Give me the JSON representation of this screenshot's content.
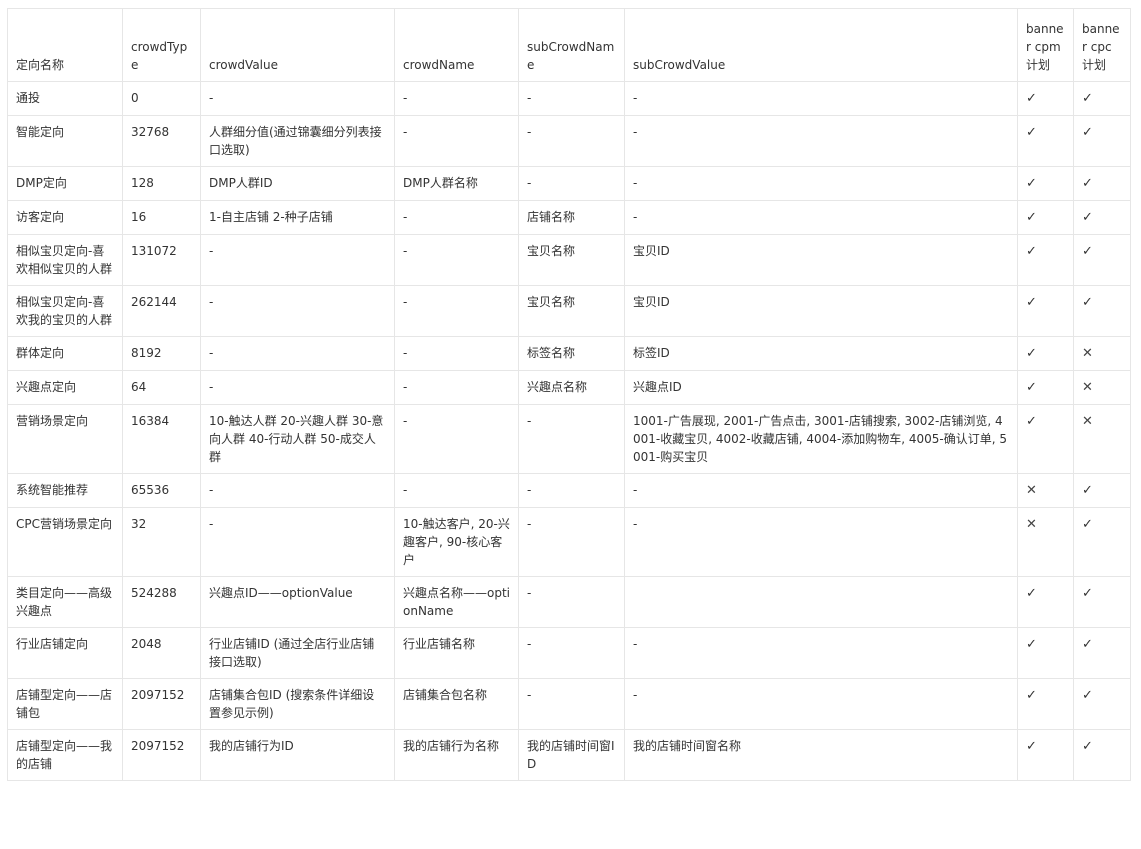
{
  "headers": [
    "定向名称",
    "crowdType",
    "crowdValue",
    "crowdName",
    "subCrowdName",
    "subCrowdValue",
    "banner cpm计划",
    "banner cpc计划"
  ],
  "marks": {
    "yes": "✓",
    "no": "✕"
  },
  "rows": [
    {
      "name": "通投",
      "type": "0",
      "value": "-",
      "crowdName": "-",
      "subName": "-",
      "subValue": "-",
      "cpm": "yes",
      "cpc": "yes"
    },
    {
      "name": "智能定向",
      "type": "32768",
      "value": "人群细分值(通过锦囊细分列表接口选取)",
      "crowdName": "-",
      "subName": "-",
      "subValue": "-",
      "cpm": "yes",
      "cpc": "yes"
    },
    {
      "name": "DMP定向",
      "type": "128",
      "value": "DMP人群ID",
      "crowdName": "DMP人群名称",
      "subName": "-",
      "subValue": "-",
      "cpm": "yes",
      "cpc": "yes"
    },
    {
      "name": "访客定向",
      "type": "16",
      "value": "1-自主店铺 2-种子店铺",
      "crowdName": "-",
      "subName": "店铺名称",
      "subValue": "-",
      "cpm": "yes",
      "cpc": "yes"
    },
    {
      "name": "相似宝贝定向-喜欢相似宝贝的人群",
      "type": "131072",
      "value": "-",
      "crowdName": "-",
      "subName": "宝贝名称",
      "subValue": "宝贝ID",
      "cpm": "yes",
      "cpc": "yes"
    },
    {
      "name": "相似宝贝定向-喜欢我的宝贝的人群",
      "type": "262144",
      "value": "-",
      "crowdName": "-",
      "subName": "宝贝名称",
      "subValue": "宝贝ID",
      "cpm": "yes",
      "cpc": "yes"
    },
    {
      "name": "群体定向",
      "type": "8192",
      "value": "-",
      "crowdName": "-",
      "subName": "标签名称",
      "subValue": "标签ID",
      "cpm": "yes",
      "cpc": "no"
    },
    {
      "name": "兴趣点定向",
      "type": "64",
      "value": "-",
      "crowdName": "-",
      "subName": "兴趣点名称",
      "subValue": "兴趣点ID",
      "cpm": "yes",
      "cpc": "no"
    },
    {
      "name": "营销场景定向",
      "type": "16384",
      "value": "10-触达人群 20-兴趣人群 30-意向人群 40-行动人群 50-成交人群",
      "crowdName": "-",
      "subName": "-",
      "subValue": "1001-广告展现, 2001-广告点击, 3001-店铺搜索, 3002-店铺浏览, 4001-收藏宝贝, 4002-收藏店铺, 4004-添加购物车, 4005-确认订单, 5001-购买宝贝",
      "cpm": "yes",
      "cpc": "no"
    },
    {
      "name": "系统智能推荐",
      "type": "65536",
      "value": "-",
      "crowdName": "-",
      "subName": "-",
      "subValue": "-",
      "cpm": "no",
      "cpc": "yes"
    },
    {
      "name": "CPC营销场景定向",
      "type": "32",
      "value": "-",
      "crowdName": "10-触达客户, 20-兴趣客户, 90-核心客户",
      "subName": "-",
      "subValue": "-",
      "cpm": "no",
      "cpc": "yes"
    },
    {
      "name": "类目定向——高级兴趣点",
      "type": "524288",
      "value": "兴趣点ID——optionValue",
      "crowdName": "兴趣点名称——optionName",
      "subName": "-",
      "subValue": "",
      "cpm": "yes",
      "cpc": "yes"
    },
    {
      "name": "行业店铺定向",
      "type": "2048",
      "value": "行业店铺ID (通过全店行业店铺接口选取)",
      "crowdName": "行业店铺名称",
      "subName": "-",
      "subValue": "-",
      "cpm": "yes",
      "cpc": "yes"
    },
    {
      "name": "店铺型定向——店铺包",
      "type": "2097152",
      "value": "店铺集合包ID (搜索条件详细设置参见示例)",
      "crowdName": "店铺集合包名称",
      "subName": "-",
      "subValue": "-",
      "cpm": "yes",
      "cpc": "yes"
    },
    {
      "name": "店铺型定向——我的店铺",
      "type": "2097152",
      "value": "我的店铺行为ID",
      "crowdName": "我的店铺行为名称",
      "subName": "我的店铺时间窗ID",
      "subValue": "我的店铺时间窗名称",
      "cpm": "yes",
      "cpc": "yes"
    }
  ]
}
